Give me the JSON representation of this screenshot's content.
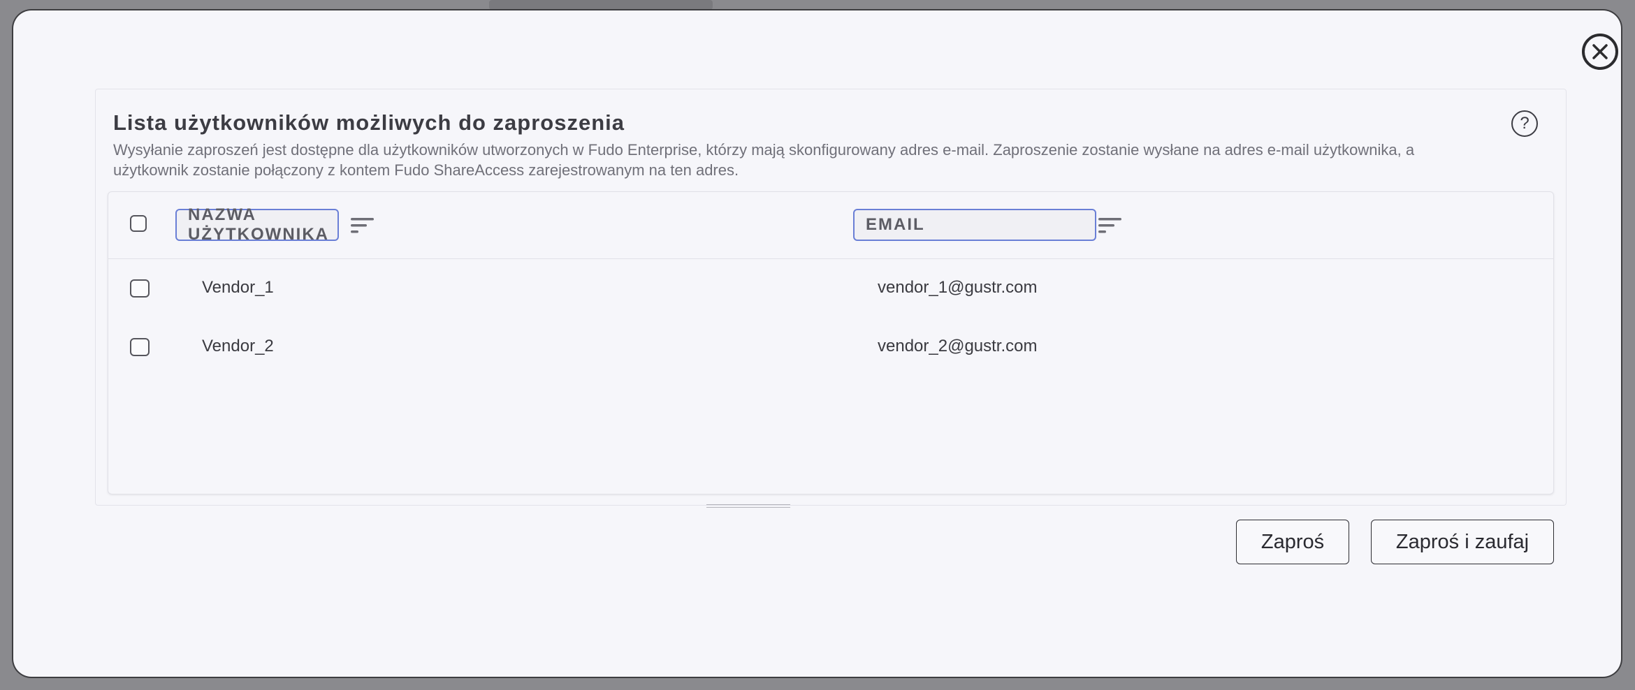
{
  "modal": {
    "title": "Lista użytkowników możliwych do zaproszenia",
    "description": "Wysyłanie zaproszeń jest dostępne dla użytkowników utworzonych w Fudo Enterprise, którzy mają skonfigurowany adres e-mail. Zaproszenie zostanie wysłane na adres e-mail użytkownika, a użytkownik zostanie połączony z kontem Fudo ShareAccess zarejestrowanym na ten adres.",
    "help_symbol": "?"
  },
  "table": {
    "columns": [
      {
        "label": "NAZWA UŻYTKOWNIKA"
      },
      {
        "label": "EMAIL"
      }
    ],
    "rows": [
      {
        "username": "Vendor_1",
        "email": "vendor_1@gustr.com"
      },
      {
        "username": "Vendor_2",
        "email": "vendor_2@gustr.com"
      }
    ]
  },
  "actions": {
    "invite_label": "Zaproś",
    "invite_trust_label": "Zaproś i zaufaj"
  },
  "icons": {
    "close": "close-icon",
    "help": "question-circle-icon",
    "sort": "sort-lines-icon"
  },
  "colors": {
    "filter_border": "#6a7fd6",
    "text_primary": "#3c3c43",
    "text_muted": "#707079",
    "modal_background": "#f6f6fa"
  }
}
